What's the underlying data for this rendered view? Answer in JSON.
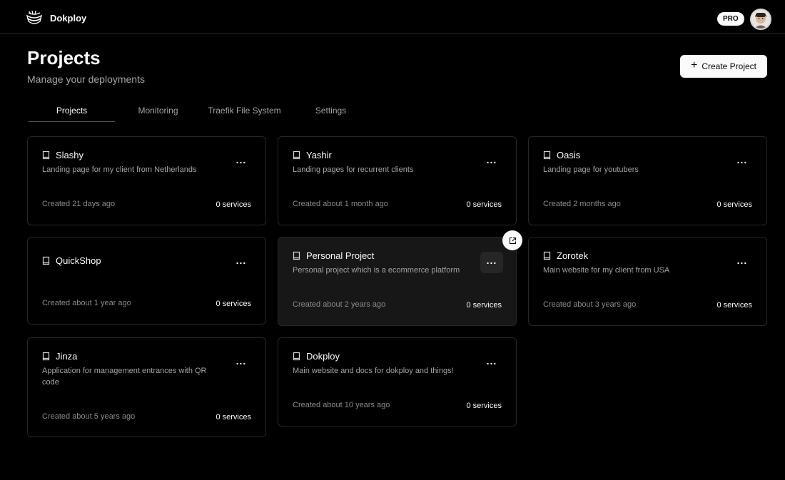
{
  "header": {
    "brand": "Dokploy",
    "badge": "PRO"
  },
  "page": {
    "title": "Projects",
    "subtitle": "Manage your deployments",
    "create_label": "Create Project"
  },
  "tabs": [
    {
      "label": "Projects",
      "active": true
    },
    {
      "label": "Monitoring",
      "active": false
    },
    {
      "label": "Traefik File System",
      "active": false
    },
    {
      "label": "Settings",
      "active": false
    }
  ],
  "projects": [
    {
      "name": "Slashy",
      "description": "Landing page for my client from Netherlands",
      "created": "Created 21 days ago",
      "services": "0 services"
    },
    {
      "name": "Yashir",
      "description": "Landing pages for recurrent clients",
      "created": "Created about 1 month ago",
      "services": "0 services"
    },
    {
      "name": "Oasis",
      "description": "Landing page for youtubers",
      "created": "Created 2 months ago",
      "services": "0 services"
    },
    {
      "name": "QuickShop",
      "description": "",
      "created": "Created about 1 year ago",
      "services": "0 services"
    },
    {
      "name": "Personal Project",
      "description": "Personal project which is a ecommerce platform",
      "created": "Created about 2 years ago",
      "services": "0 services"
    },
    {
      "name": "Zorotek",
      "description": "Main website for my client from USA",
      "created": "Created about 3 years ago",
      "services": "0 services"
    },
    {
      "name": "Jinza",
      "description": "Application for management entrances with QR code",
      "created": "Created about 5 years ago",
      "services": "0 services"
    },
    {
      "name": "Dokploy",
      "description": "Main website and docs for dokploy and things!",
      "created": "Created about 10 years ago",
      "services": "0 services"
    }
  ]
}
